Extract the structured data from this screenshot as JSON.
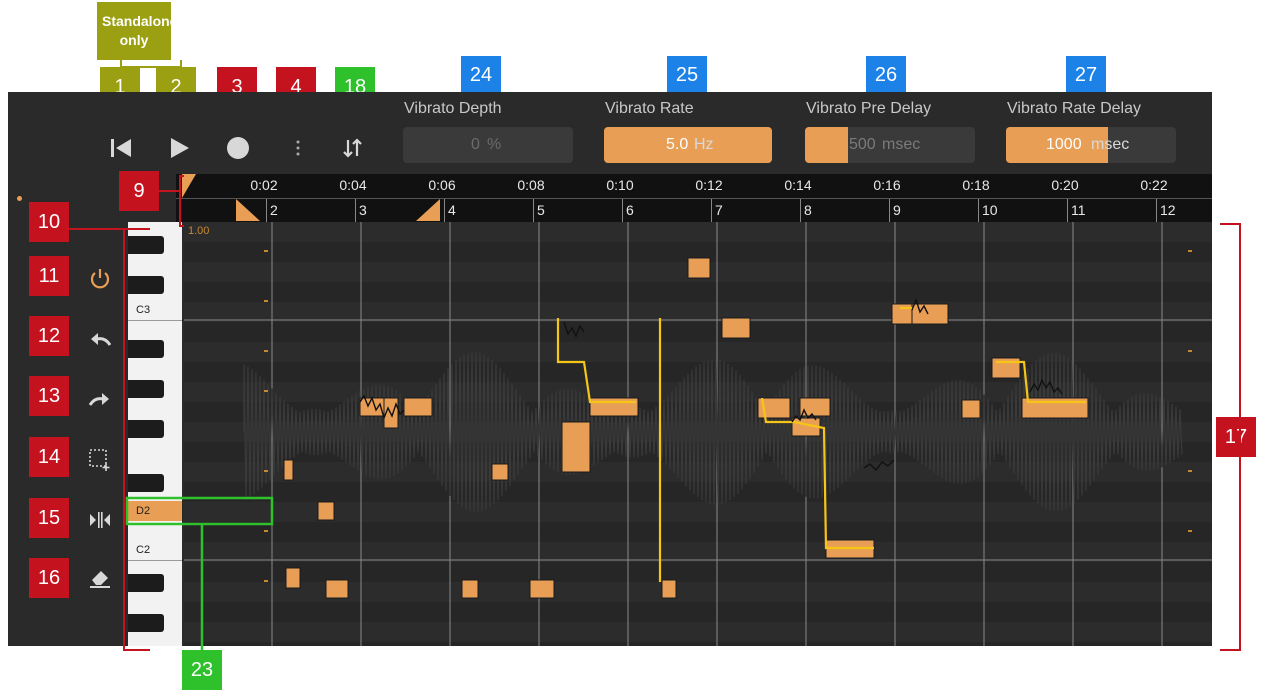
{
  "badges": {
    "standalone_only": "Standalone only",
    "b1": "1",
    "b2": "2",
    "b3": "3",
    "b4": "4",
    "b18": "18",
    "b24": "24",
    "b25": "25",
    "b26": "26",
    "b27": "27",
    "b9": "9",
    "b10": "10",
    "b11": "11",
    "b12": "12",
    "b13": "13",
    "b14": "14",
    "b15": "15",
    "b16": "16",
    "b17": "17",
    "b23": "23"
  },
  "controls": {
    "vibrato_depth": {
      "label": "Vibrato Depth",
      "value": "0",
      "unit": "%",
      "fill_fraction": 0
    },
    "vibrato_rate": {
      "label": "Vibrato Rate",
      "value": "5.0",
      "unit": "Hz",
      "fill_fraction": 1.0
    },
    "vibrato_pre_delay": {
      "label": "Vibrato Pre Delay",
      "value": "500",
      "unit": "msec",
      "fill_fraction": 0.25
    },
    "vibrato_rate_delay": {
      "label": "Vibrato Rate Delay",
      "value": "1000",
      "unit": "msec",
      "fill_fraction": 0.6
    }
  },
  "timeline": {
    "times": [
      "0:02",
      "0:04",
      "0:06",
      "0:08",
      "0:10",
      "0:12",
      "0:14",
      "0:16",
      "0:18",
      "0:20",
      "0:22"
    ],
    "bars": [
      "2",
      "3",
      "4",
      "5",
      "6",
      "7",
      "8",
      "9",
      "10",
      "11",
      "12"
    ],
    "gain": "1.00"
  },
  "keyboard": {
    "labels": [
      "C3",
      "D2",
      "C2"
    ],
    "selected": "D2"
  },
  "icons": {
    "skip_back": "skip-back-icon",
    "play": "play-icon",
    "record": "record-icon",
    "more": "more-icon",
    "sort": "sort-icon",
    "power": "power-icon",
    "undo": "undo-icon",
    "redo": "redo-icon",
    "select": "select-add-icon",
    "split": "split-icon",
    "eraser": "eraser-icon"
  },
  "colors": {
    "accent": "#e89f55",
    "pitch_line": "#f5c518",
    "panel": "#2a2a2a",
    "badge_red": "#c4121f",
    "badge_blue": "#1c82e8",
    "badge_green": "#2ec12c",
    "badge_olive": "#9aa012"
  }
}
